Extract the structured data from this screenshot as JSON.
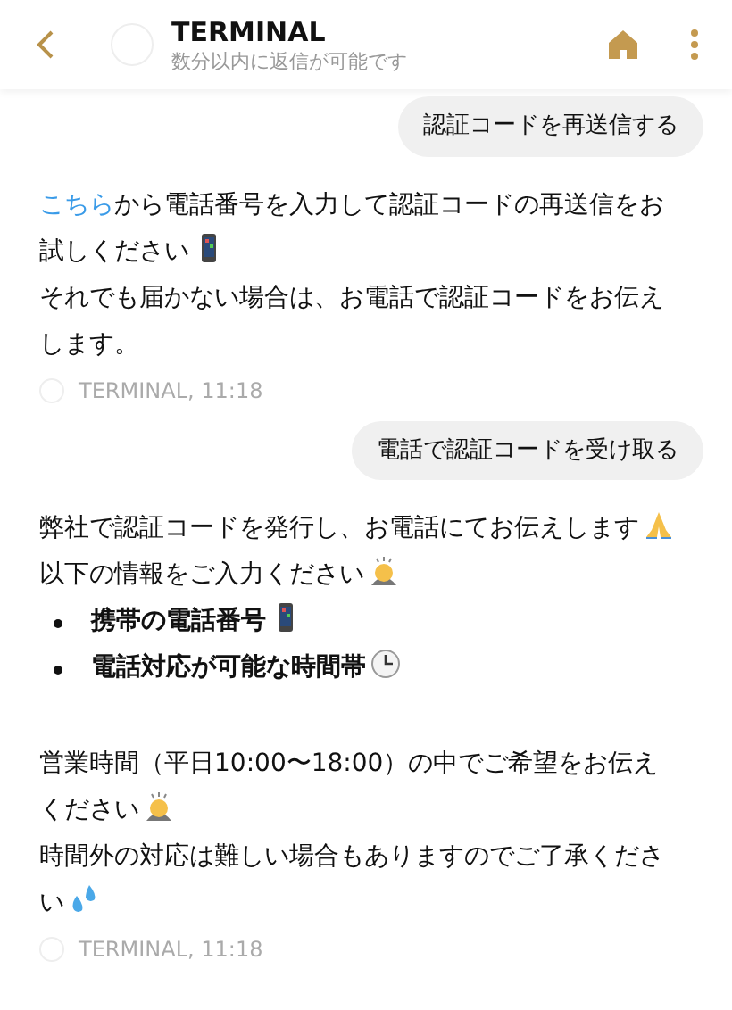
{
  "header": {
    "title": "TERMINAL",
    "subtitle": "数分以内に返信が可能です"
  },
  "messages": [
    {
      "kind": "user",
      "text": "認証コードを再送信する"
    },
    {
      "kind": "bot",
      "paragraphs": [
        [
          {
            "kind": "link",
            "text": "こちら"
          },
          {
            "kind": "text",
            "text": "から電話番号を入力して認証コードの再送信をお試しください"
          },
          {
            "kind": "phone"
          }
        ],
        [
          {
            "kind": "text",
            "text": "それでも届かない場合は、お電話で認証コードをお伝えします。"
          }
        ]
      ],
      "meta": "TERMINAL, 11:18"
    },
    {
      "kind": "user",
      "text": "電話で認証コードを受け取る"
    },
    {
      "kind": "bot",
      "paragraphs": [
        [
          {
            "kind": "text",
            "text": "弊社で認証コードを発行し、お電話にてお伝えします"
          },
          {
            "kind": "pray"
          }
        ],
        [
          {
            "kind": "text",
            "text": "以下の情報をご入力ください"
          },
          {
            "kind": "bow"
          }
        ],
        [
          {
            "kind": "bullet",
            "text": "携帯の電話番号"
          },
          {
            "kind": "phone"
          }
        ],
        [
          {
            "kind": "bullet",
            "text": "電話対応が可能な時間帯"
          },
          {
            "kind": "clock"
          }
        ],
        [
          {
            "kind": "gap"
          }
        ],
        [
          {
            "kind": "text",
            "text": "営業時間（平日10:00〜18:00）の中でご希望をお伝えください"
          },
          {
            "kind": "bow"
          }
        ],
        [
          {
            "kind": "text",
            "text": "時間外の対応は難しい場合もありますのでご了承ください"
          },
          {
            "kind": "drops"
          }
        ]
      ],
      "meta": "TERMINAL, 11:18"
    }
  ]
}
